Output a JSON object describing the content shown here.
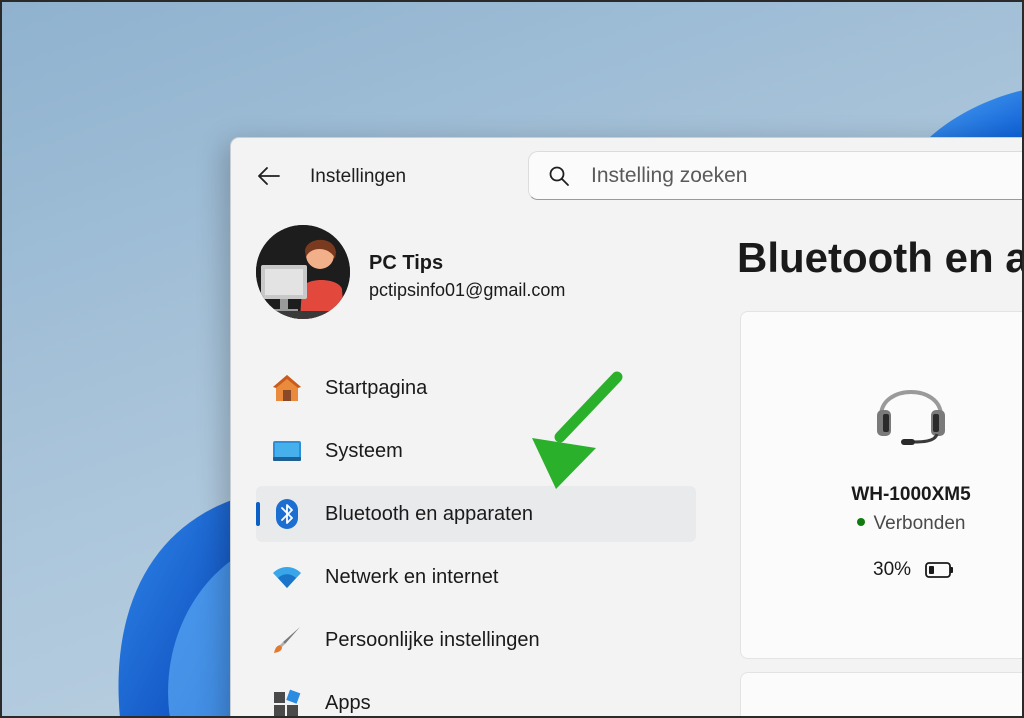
{
  "window": {
    "title": "Instellingen"
  },
  "search": {
    "placeholder": "Instelling zoeken"
  },
  "user": {
    "name": "PC Tips",
    "email": "pctipsinfo01@gmail.com"
  },
  "nav": {
    "items": [
      {
        "label": "Startpagina",
        "icon": "home-icon",
        "active": false
      },
      {
        "label": "Systeem",
        "icon": "monitor-icon",
        "active": false
      },
      {
        "label": "Bluetooth en apparaten",
        "icon": "bluetooth-icon",
        "active": true
      },
      {
        "label": "Netwerk en internet",
        "icon": "wifi-icon",
        "active": false
      },
      {
        "label": "Persoonlijke instellingen",
        "icon": "paintbrush-icon",
        "active": false
      },
      {
        "label": "Apps",
        "icon": "apps-icon",
        "active": false
      }
    ]
  },
  "main": {
    "title": "Bluetooth en a",
    "device": {
      "name": "WH-1000XM5",
      "status": "Verbonden",
      "battery": "30%",
      "icon": "headset-icon"
    }
  },
  "colors": {
    "accent": "#0a5fc7",
    "connected": "#107c10",
    "annotation_arrow": "#2bb02b"
  }
}
